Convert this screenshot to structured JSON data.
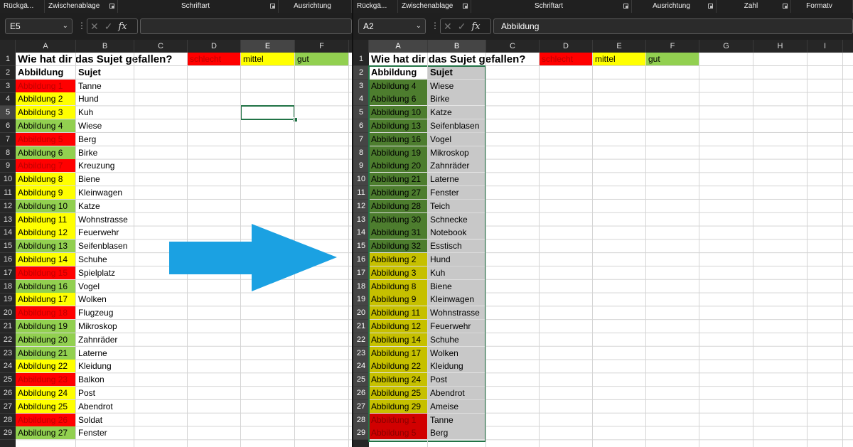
{
  "left": {
    "ribbon": [
      {
        "label": "Rückgä...",
        "width": 63,
        "launcher": false,
        "center": false
      },
      {
        "label": "Zwischenablage",
        "width": 103,
        "launcher": true,
        "center": false
      },
      {
        "label": "Schriftart",
        "width": 226,
        "launcher": true,
        "center": true
      },
      {
        "label": "Ausrichtung",
        "width": 103,
        "launcher": false,
        "center": true
      }
    ],
    "namebox": "E5",
    "formula": "",
    "columns": [
      "A",
      "B",
      "C",
      "D",
      "E",
      "F"
    ],
    "selected_col": "E",
    "selected_row": 5,
    "title": "Wie hat dir das Sujet gefallen?",
    "legend": [
      "schlecht",
      "mittel",
      "gut"
    ],
    "headers": [
      "Abbildung",
      "Sujet"
    ],
    "rows": [
      {
        "a": "Abbildung 1",
        "b": "Tanne",
        "rating": "schlecht"
      },
      {
        "a": "Abbildung 2",
        "b": "Hund",
        "rating": "mittel"
      },
      {
        "a": "Abbildung 3",
        "b": "Kuh",
        "rating": "mittel"
      },
      {
        "a": "Abbildung 4",
        "b": "Wiese",
        "rating": "gut"
      },
      {
        "a": "Abbildung 5",
        "b": "Berg",
        "rating": "schlecht"
      },
      {
        "a": "Abbildung 6",
        "b": "Birke",
        "rating": "gut"
      },
      {
        "a": "Abbildung 7",
        "b": "Kreuzung",
        "rating": "schlecht"
      },
      {
        "a": "Abbildung 8",
        "b": "Biene",
        "rating": "mittel"
      },
      {
        "a": "Abbildung 9",
        "b": "Kleinwagen",
        "rating": "mittel"
      },
      {
        "a": "Abbildung 10",
        "b": "Katze",
        "rating": "gut"
      },
      {
        "a": "Abbildung 11",
        "b": "Wohnstrasse",
        "rating": "mittel"
      },
      {
        "a": "Abbildung 12",
        "b": "Feuerwehr",
        "rating": "mittel"
      },
      {
        "a": "Abbildung 13",
        "b": "Seifenblasen",
        "rating": "gut"
      },
      {
        "a": "Abbildung 14",
        "b": "Schuhe",
        "rating": "mittel"
      },
      {
        "a": "Abbildung 15",
        "b": "Spielplatz",
        "rating": "schlecht"
      },
      {
        "a": "Abbildung 16",
        "b": "Vogel",
        "rating": "gut"
      },
      {
        "a": "Abbildung 17",
        "b": "Wolken",
        "rating": "mittel"
      },
      {
        "a": "Abbildung 18",
        "b": "Flugzeug",
        "rating": "schlecht"
      },
      {
        "a": "Abbildung 19",
        "b": "Mikroskop",
        "rating": "gut"
      },
      {
        "a": "Abbildung 20",
        "b": "Zahnräder",
        "rating": "gut"
      },
      {
        "a": "Abbildung 21",
        "b": "Laterne",
        "rating": "gut"
      },
      {
        "a": "Abbildung 22",
        "b": "Kleidung",
        "rating": "mittel"
      },
      {
        "a": "Abbildung 23",
        "b": "Balkon",
        "rating": "schlecht"
      },
      {
        "a": "Abbildung 24",
        "b": "Post",
        "rating": "mittel"
      },
      {
        "a": "Abbildung 25",
        "b": "Abendrot",
        "rating": "mittel"
      },
      {
        "a": "Abbildung 26",
        "b": "Soldat",
        "rating": "schlecht"
      },
      {
        "a": "Abbildung 27",
        "b": "Fenster",
        "rating": "gut"
      }
    ]
  },
  "right": {
    "ribbon": [
      {
        "label": "Rückgä...",
        "width": 63,
        "launcher": false,
        "center": false
      },
      {
        "label": "Zwischenablage",
        "width": 103,
        "launcher": true,
        "center": false
      },
      {
        "label": "Schriftart",
        "width": 226,
        "launcher": true,
        "center": true
      },
      {
        "label": "Ausrichtung",
        "width": 119,
        "launcher": true,
        "center": true
      },
      {
        "label": "Zahl",
        "width": 105,
        "launcher": true,
        "center": true
      },
      {
        "label": "Formatv",
        "width": 87,
        "launcher": false,
        "center": true
      }
    ],
    "namebox": "A2",
    "formula": "Abbildung",
    "columns": [
      "A",
      "B",
      "C",
      "D",
      "E",
      "F",
      "G",
      "H",
      "I"
    ],
    "selected_col": "A B",
    "selected_row": "2-29",
    "title": "Wie hat dir das Sujet gefallen?",
    "legend": [
      "schlecht",
      "mittel",
      "gut"
    ],
    "headers": [
      "Abbildung",
      "Sujet"
    ],
    "rows": [
      {
        "a": "Abbildung 4",
        "b": "Wiese",
        "rating": "gut"
      },
      {
        "a": "Abbildung 6",
        "b": "Birke",
        "rating": "gut"
      },
      {
        "a": "Abbildung 10",
        "b": "Katze",
        "rating": "gut"
      },
      {
        "a": "Abbildung 13",
        "b": "Seifenblasen",
        "rating": "gut"
      },
      {
        "a": "Abbildung 16",
        "b": "Vogel",
        "rating": "gut"
      },
      {
        "a": "Abbildung 19",
        "b": "Mikroskop",
        "rating": "gut"
      },
      {
        "a": "Abbildung 20",
        "b": "Zahnräder",
        "rating": "gut"
      },
      {
        "a": "Abbildung 21",
        "b": "Laterne",
        "rating": "gut"
      },
      {
        "a": "Abbildung 27",
        "b": "Fenster",
        "rating": "gut"
      },
      {
        "a": "Abbildung 28",
        "b": "Teich",
        "rating": "gut"
      },
      {
        "a": "Abbildung 30",
        "b": "Schnecke",
        "rating": "gut"
      },
      {
        "a": "Abbildung 31",
        "b": "Notebook",
        "rating": "gut"
      },
      {
        "a": "Abbildung 32",
        "b": "Esstisch",
        "rating": "gut"
      },
      {
        "a": "Abbildung 2",
        "b": "Hund",
        "rating": "mittel"
      },
      {
        "a": "Abbildung 3",
        "b": "Kuh",
        "rating": "mittel"
      },
      {
        "a": "Abbildung 8",
        "b": "Biene",
        "rating": "mittel"
      },
      {
        "a": "Abbildung 9",
        "b": "Kleinwagen",
        "rating": "mittel"
      },
      {
        "a": "Abbildung 11",
        "b": "Wohnstrasse",
        "rating": "mittel"
      },
      {
        "a": "Abbildung 12",
        "b": "Feuerwehr",
        "rating": "mittel"
      },
      {
        "a": "Abbildung 14",
        "b": "Schuhe",
        "rating": "mittel"
      },
      {
        "a": "Abbildung 17",
        "b": "Wolken",
        "rating": "mittel"
      },
      {
        "a": "Abbildung 22",
        "b": "Kleidung",
        "rating": "mittel"
      },
      {
        "a": "Abbildung 24",
        "b": "Post",
        "rating": "mittel"
      },
      {
        "a": "Abbildung 25",
        "b": "Abendrot",
        "rating": "mittel"
      },
      {
        "a": "Abbildung 29",
        "b": "Ameise",
        "rating": "mittel"
      },
      {
        "a": "Abbildung 1",
        "b": "Tanne",
        "rating": "schlecht"
      },
      {
        "a": "Abbildung 5",
        "b": "Berg",
        "rating": "schlecht"
      }
    ]
  },
  "colors": {
    "schlecht": "#ff0000",
    "mittel": "#ffff00",
    "gut": "#92d050",
    "schlecht_text": "#c00000",
    "right_gut_fill": "#4d7d2e",
    "right_mittel_fill": "#c6c000",
    "right_schlecht_fill": "#d10000",
    "right_sel_b_fill": "#c8c8c8",
    "selection": "#217346",
    "arrow": "#1ba1e2"
  },
  "icons": {
    "namebox_dropdown": "chevron-down-icon",
    "formula_cancel": "close-icon",
    "formula_enter": "check-icon",
    "formula_fx": "fx-icon",
    "transform_arrow": "right-arrow-icon"
  }
}
